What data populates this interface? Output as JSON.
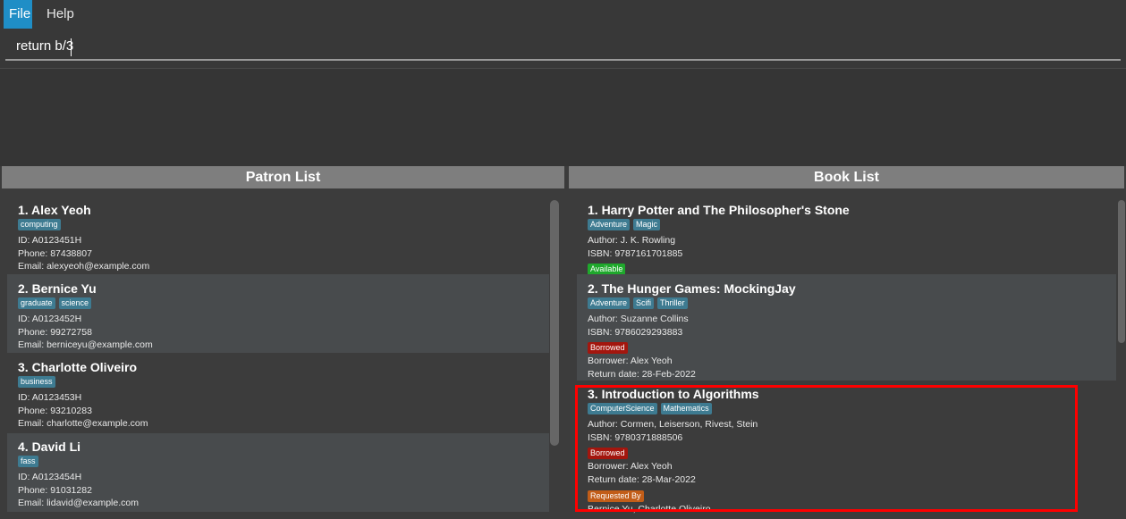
{
  "menu": {
    "file": "File",
    "help": "Help"
  },
  "command": {
    "value": "return b/3"
  },
  "patron_list": {
    "header": "Patron List",
    "patrons": [
      {
        "title": "1.  Alex Yeoh",
        "tags": [
          "computing"
        ],
        "id": "ID: A0123451H",
        "phone": "Phone: 87438807",
        "email": "Email: alexyeoh@example.com"
      },
      {
        "title": "2.  Bernice Yu",
        "tags": [
          "graduate",
          "science"
        ],
        "id": "ID: A0123452H",
        "phone": "Phone: 99272758",
        "email": "Email: berniceyu@example.com"
      },
      {
        "title": "3.  Charlotte Oliveiro",
        "tags": [
          "business"
        ],
        "id": "ID: A0123453H",
        "phone": "Phone: 93210283",
        "email": "Email: charlotte@example.com"
      },
      {
        "title": "4.  David Li",
        "tags": [
          "fass"
        ],
        "id": "ID: A0123454H",
        "phone": "Phone: 91031282",
        "email": "Email: lidavid@example.com"
      }
    ]
  },
  "book_list": {
    "header": "Book List",
    "books": [
      {
        "title": "1.  Harry Potter and The Philosopher's Stone",
        "tags": [
          "Adventure",
          "Magic"
        ],
        "author": "Author: J. K. Rowling",
        "isbn": "ISBN: 9787161701885",
        "status": "Available"
      },
      {
        "title": "2.  The Hunger Games: MockingJay",
        "tags": [
          "Adventure",
          "Scifi",
          "Thriller"
        ],
        "author": "Author: Suzanne Collins",
        "isbn": "ISBN: 9786029293883",
        "status": "Borrowed",
        "borrower": "Borrower: Alex Yeoh",
        "return_date": "Return date: 28-Feb-2022"
      },
      {
        "title": "3.  Introduction to Algorithms",
        "tags": [
          "ComputerScience",
          "Mathematics"
        ],
        "author": "Author: Cormen, Leiserson, Rivest, Stein",
        "isbn": "ISBN: 9780371888506",
        "status": "Borrowed",
        "borrower": "Borrower: Alex Yeoh",
        "return_date": "Return date: 28-Mar-2022",
        "requested_label": "Requested By",
        "requesters": "Bernice Yu, Charlotte Oliveiro"
      }
    ]
  },
  "colors": {
    "accent": "#1f8ec6",
    "tag": "#3e7b91",
    "available": "#1fa82c",
    "borrowed": "#a3160e",
    "requested": "#c25d18",
    "highlight": "#ff0000"
  }
}
